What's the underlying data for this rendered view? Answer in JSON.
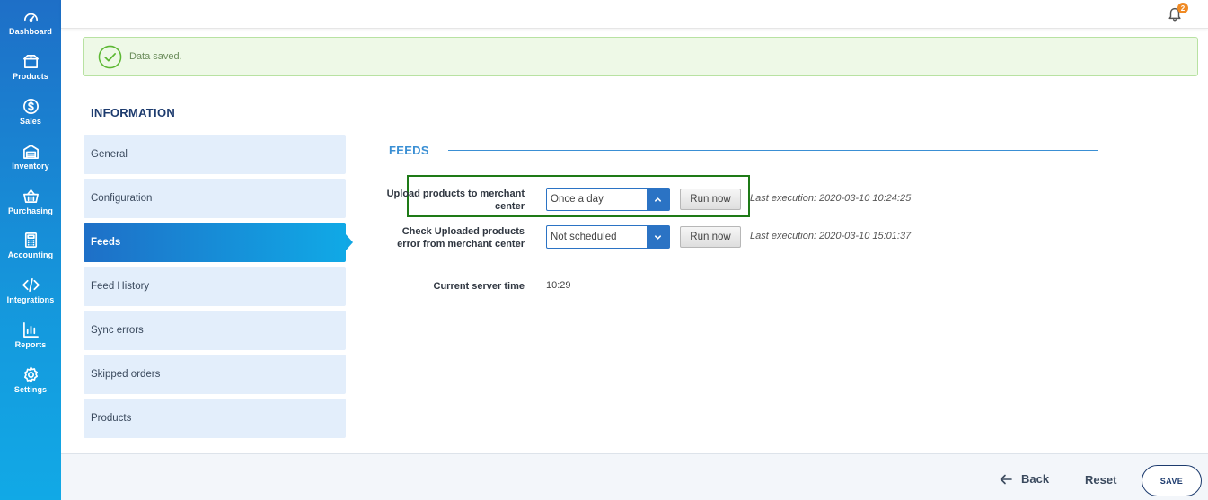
{
  "sidebar": {
    "items": [
      {
        "label": "Dashboard",
        "icon": "dashboard-icon"
      },
      {
        "label": "Products",
        "icon": "box-icon"
      },
      {
        "label": "Sales",
        "icon": "dollar-icon"
      },
      {
        "label": "Inventory",
        "icon": "warehouse-icon"
      },
      {
        "label": "Purchasing",
        "icon": "basket-icon"
      },
      {
        "label": "Accounting",
        "icon": "calculator-icon"
      },
      {
        "label": "Integrations",
        "icon": "code-icon"
      },
      {
        "label": "Reports",
        "icon": "bar-chart-icon"
      },
      {
        "label": "Settings",
        "icon": "gear-icon"
      }
    ]
  },
  "header": {
    "notification_count": "2"
  },
  "alert": {
    "message": "Data saved."
  },
  "section": {
    "title": "INFORMATION"
  },
  "tabs": [
    {
      "label": "General"
    },
    {
      "label": "Configuration"
    },
    {
      "label": "Feeds",
      "active": true
    },
    {
      "label": "Feed History"
    },
    {
      "label": "Sync errors"
    },
    {
      "label": "Skipped orders"
    },
    {
      "label": "Products"
    }
  ],
  "feeds": {
    "title": "FEEDS",
    "rows": [
      {
        "label": "Upload products to merchant center",
        "schedule": "Once a day",
        "run_label": "Run now",
        "last_execution": "Last execution: 2020-03-10 10:24:25"
      },
      {
        "label": "Check Uploaded products error from merchant center",
        "schedule": "Not scheduled",
        "run_label": "Run now",
        "last_execution": "Last execution: 2020-03-10 15:01:37"
      }
    ],
    "server_time_label": "Current server time",
    "server_time": "10:29"
  },
  "footer": {
    "back_label": "Back",
    "reset_label": "Reset",
    "save_label": "SAVE"
  },
  "colors": {
    "sidebar_top": "#1e6fc7",
    "sidebar_bottom": "#11a9e6",
    "accent": "#2b73c4",
    "success_bg": "#eef9e7",
    "highlight": "#1e7a17",
    "badge": "#f08a24"
  }
}
